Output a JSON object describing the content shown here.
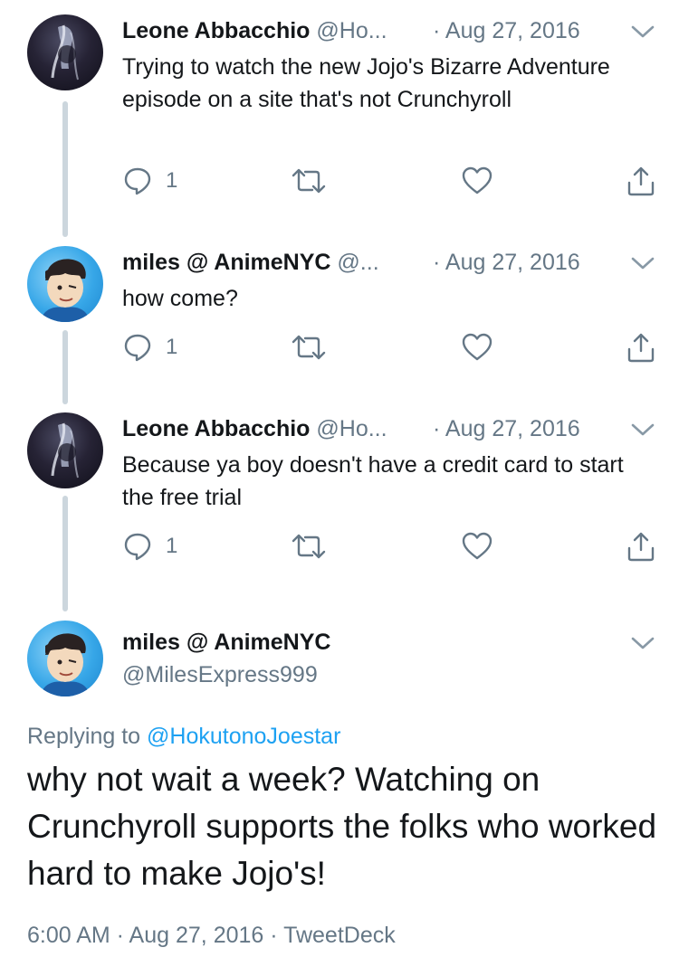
{
  "tweets": [
    {
      "name": "Leone Abbacchio",
      "handle": "@Ho...",
      "separator": "·",
      "date": "Aug 27, 2016",
      "text": "Trying to watch the new Jojo's Bizarre Adventure episode on a site that's not Crunchyroll",
      "reply_count": "1",
      "avatar_icon": "avatar-dark-portrait"
    },
    {
      "name": "miles @ AnimeNYC",
      "handle": "@...",
      "separator": "·",
      "date": "Aug 27, 2016",
      "text": "how come?",
      "reply_count": "1",
      "avatar_icon": "avatar-cartoon-portrait"
    },
    {
      "name": "Leone Abbacchio",
      "handle": "@Ho...",
      "separator": "·",
      "date": "Aug 27, 2016",
      "text": "Because ya boy doesn't have a credit card to start the free trial",
      "reply_count": "1",
      "avatar_icon": "avatar-dark-portrait"
    }
  ],
  "main_tweet": {
    "name": "miles @ AnimeNYC",
    "handle": "@MilesExpress999",
    "replying_prefix": "Replying to",
    "replying_to": "@HokutonoJoestar",
    "text": "why not wait a week? Watching on Crunchyroll supports the folks who worked hard to make Jojo's!",
    "meta": "6:00 AM · Aug 27, 2016 · TweetDeck"
  },
  "colors": {
    "text": "#14171a",
    "secondary": "#657786",
    "link": "#1da1f2",
    "thread_line": "#ccd6dd"
  },
  "icons": [
    "reply-icon",
    "retweet-icon",
    "like-icon",
    "share-icon",
    "chevron-down-icon"
  ]
}
